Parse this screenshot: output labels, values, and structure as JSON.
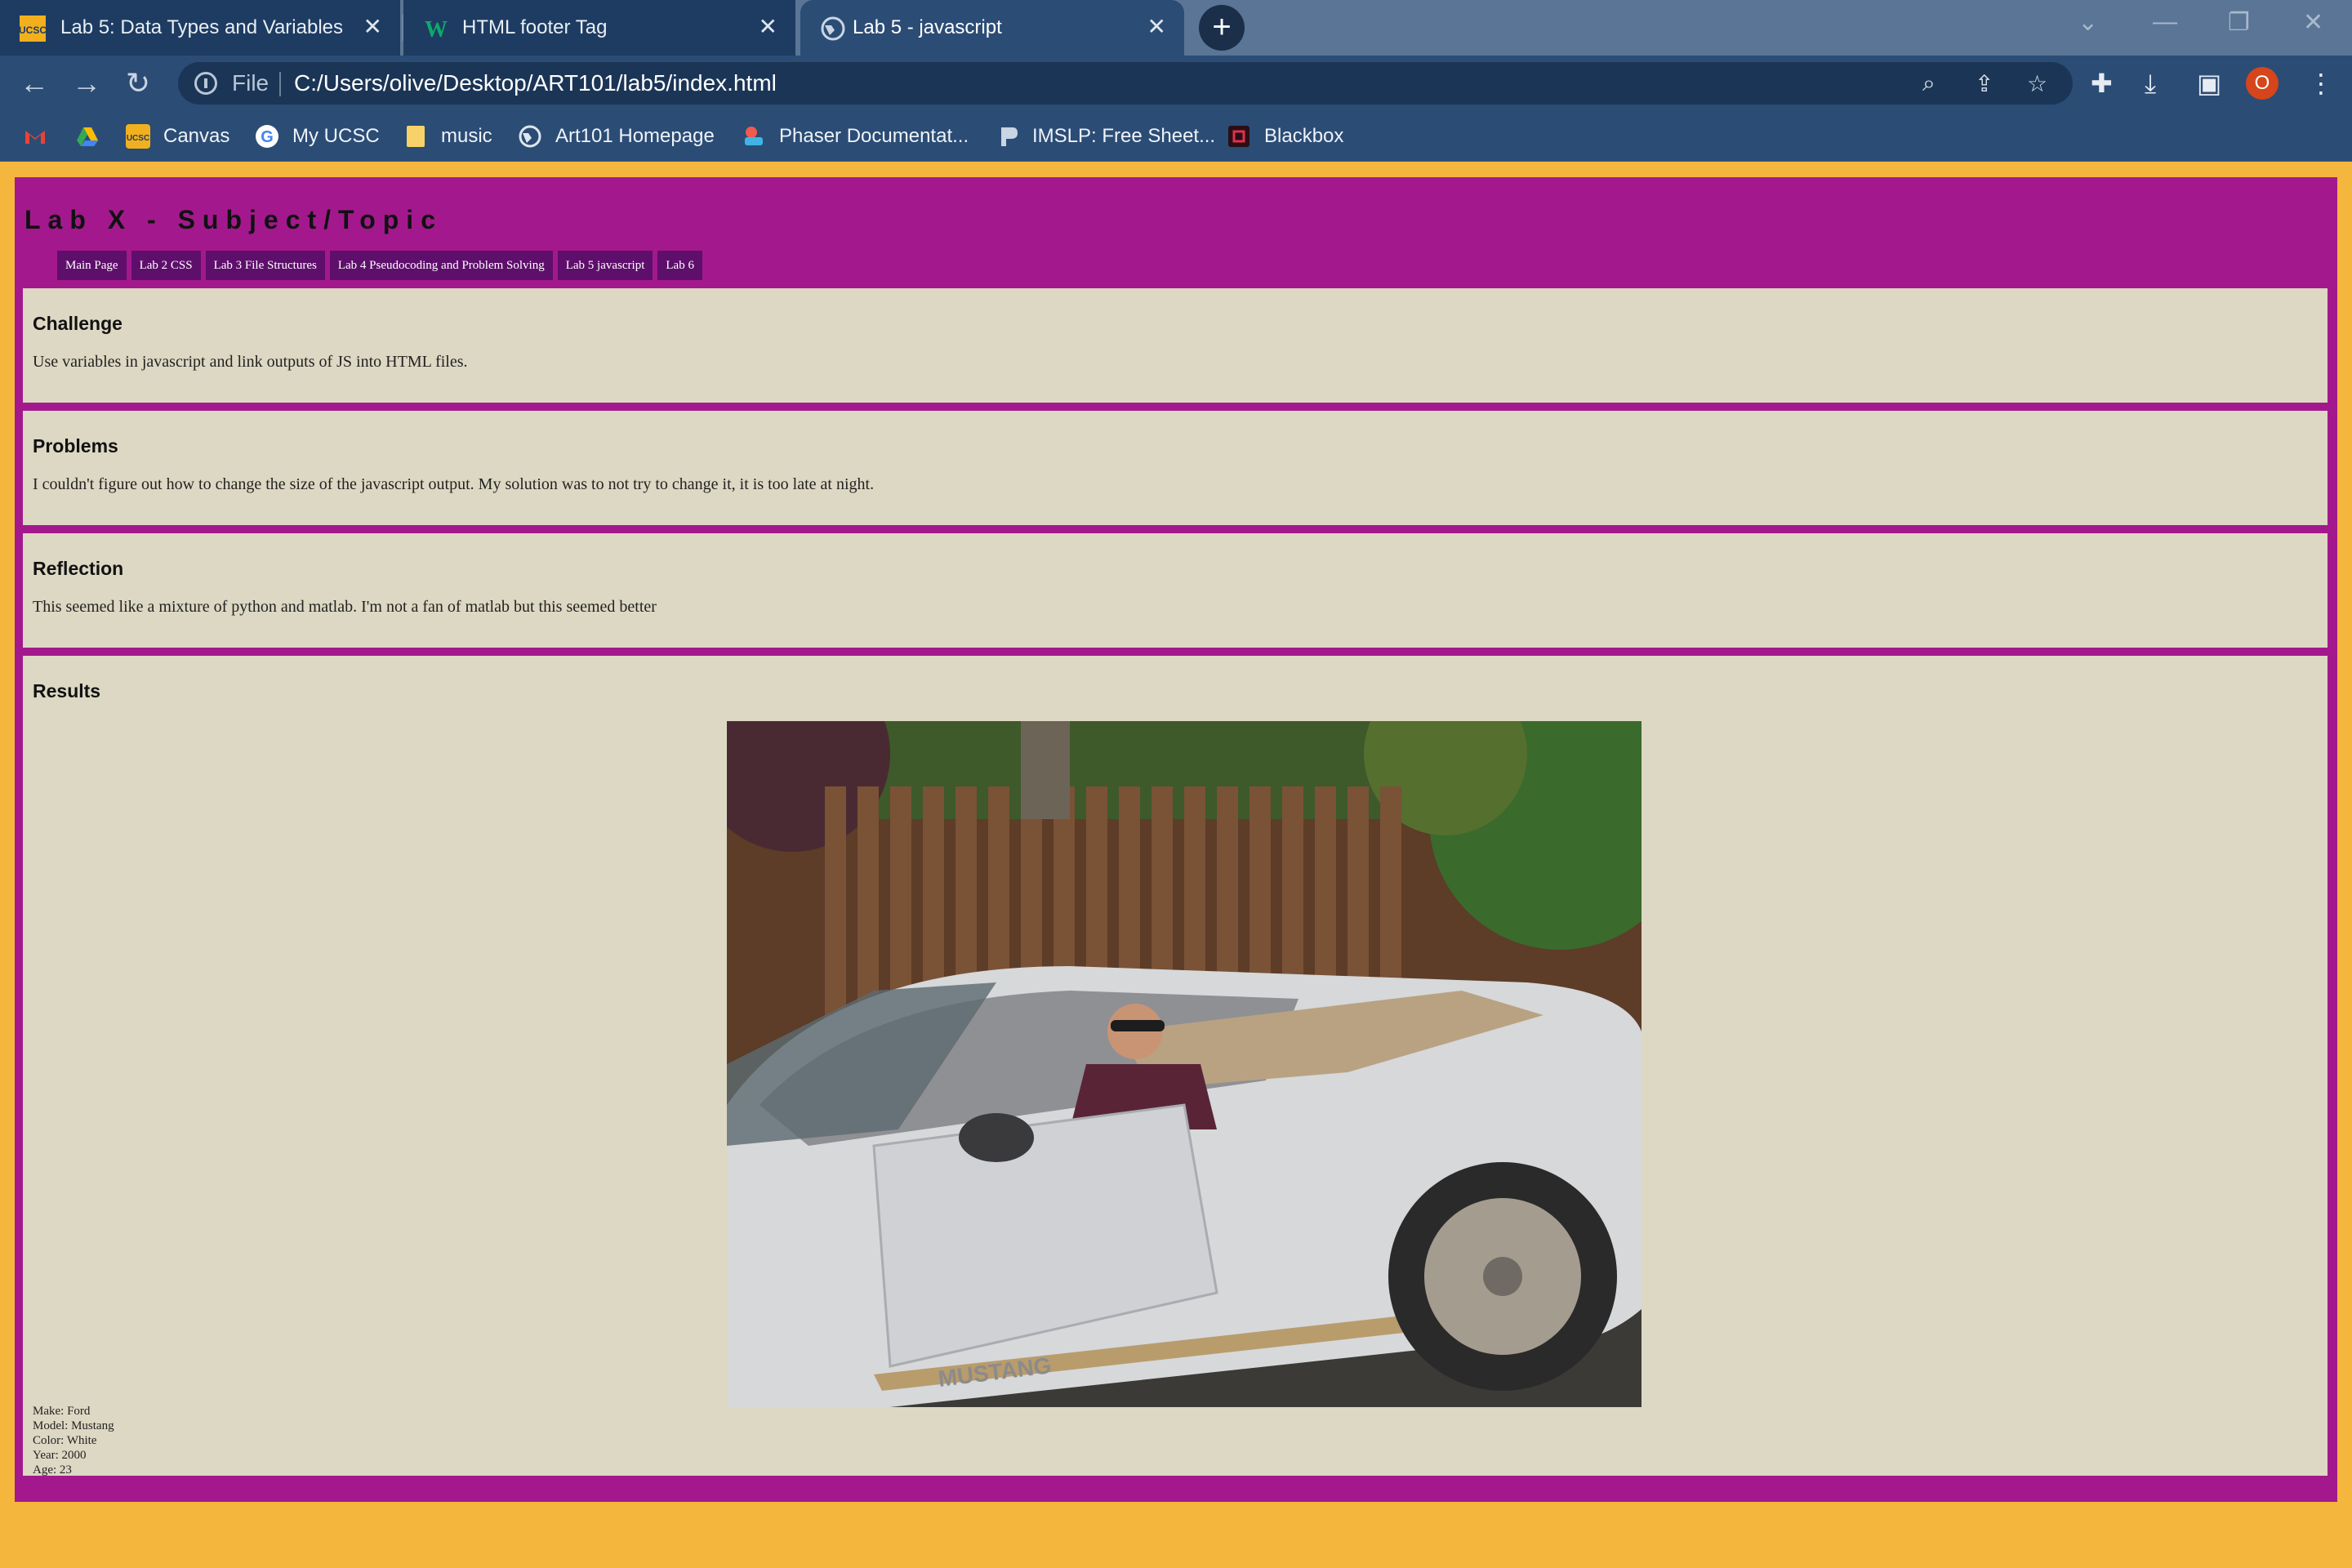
{
  "browser": {
    "tabs": [
      {
        "title": "Lab 5: Data Types and Variables",
        "icon": "ucsc-icon"
      },
      {
        "title": "HTML footer Tag",
        "icon": "w3schools-icon"
      },
      {
        "title": "Lab 5 - javascript",
        "icon": "globe-icon"
      }
    ],
    "address": {
      "scheme_label": "File",
      "url": "C:/Users/olive/Desktop/ART101/lab5/index.html"
    },
    "profile_initial": "O",
    "bookmarks": [
      {
        "label": "",
        "icon": "gmail-icon"
      },
      {
        "label": "",
        "icon": "google-drive-icon"
      },
      {
        "label": "Canvas",
        "icon": "ucsc-icon"
      },
      {
        "label": "My UCSC",
        "icon": "google-icon"
      },
      {
        "label": "music",
        "icon": "folder-icon"
      },
      {
        "label": "Art101 Homepage",
        "icon": "globe-icon"
      },
      {
        "label": "Phaser Documentat...",
        "icon": "phaser-icon"
      },
      {
        "label": "IMSLP: Free Sheet...",
        "icon": "imslp-icon"
      },
      {
        "label": "Blackbox",
        "icon": "blackbox-icon"
      }
    ]
  },
  "page": {
    "title": "Lab X - Subject/Topic",
    "nav": [
      "Main Page",
      "Lab 2 CSS",
      "Lab 3 File Structures",
      "Lab 4 Pseudocoding and Problem Solving",
      "Lab 5 javascript",
      "Lab 6"
    ],
    "sections": [
      {
        "heading": "Challenge",
        "body": "Use variables in javascript and link outputs of JS into HTML files."
      },
      {
        "heading": "Problems",
        "body": "I couldn't figure out how to change the size of the javascript output. My solution was to not try to change it, it is too late at night."
      },
      {
        "heading": "Reflection",
        "body": "This seemed like a mixture of python and matlab. I'm not a fan of matlab but this seemed better"
      }
    ],
    "results": {
      "heading": "Results",
      "car_text": "MUSTANG",
      "car_info": [
        "Make: Ford",
        "Model: Mustang",
        "Color: White",
        "Year: 2000",
        "Age: 23"
      ]
    }
  },
  "colors": {
    "page_bg": "#f5b63d",
    "container_bg": "#a3198d",
    "section_bg": "#ddd8c3",
    "nav_link_bg": "#5e0f6b",
    "browser_toolbar": "#2b4c75"
  }
}
